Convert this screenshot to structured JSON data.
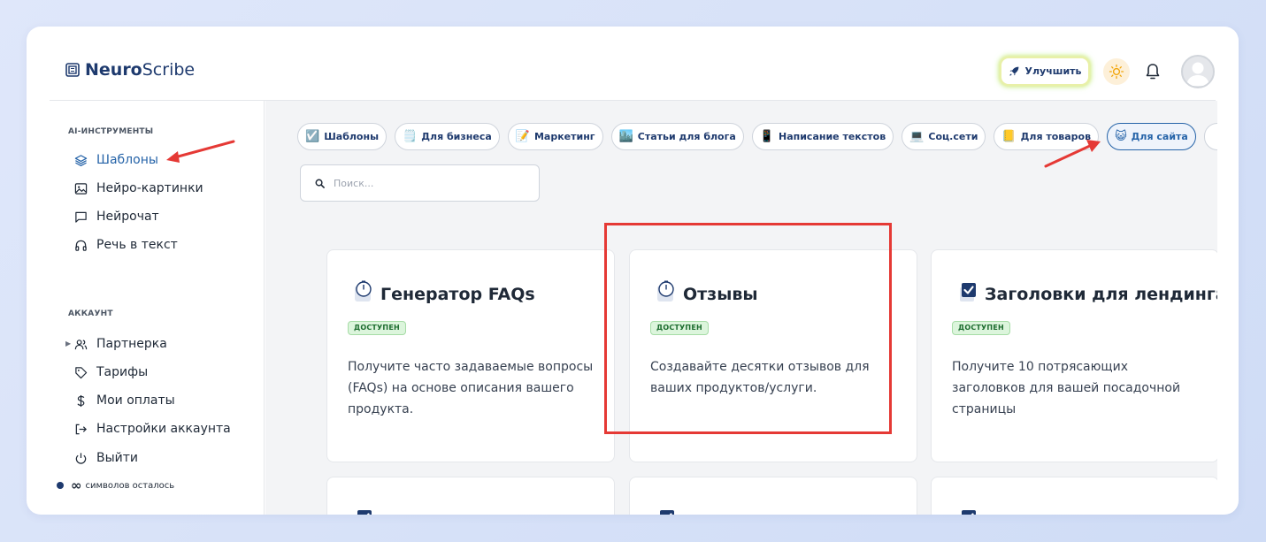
{
  "app": {
    "logo_bold": "Neuro",
    "logo_regular": "Scribe"
  },
  "header": {
    "upgrade_label": "Улучшить"
  },
  "sidebar": {
    "section_ai": "AI-ИНСТРУМЕНТЫ",
    "ai_items": [
      {
        "label": "Шаблоны",
        "icon": "layers-icon",
        "active": true
      },
      {
        "label": "Нейро-картинки",
        "icon": "image-icon"
      },
      {
        "label": "Нейрочат",
        "icon": "chat-icon"
      },
      {
        "label": "Речь в текст",
        "icon": "headphones-icon"
      }
    ],
    "section_account": "АККАУНТ",
    "account_items": [
      {
        "label": "Партнерка",
        "icon": "users-icon"
      },
      {
        "label": "Тарифы",
        "icon": "tag-icon"
      },
      {
        "label": "Мои оплаты",
        "icon": "dollar-icon"
      },
      {
        "label": "Настройки аккаунта",
        "icon": "logout-icon"
      },
      {
        "label": "Выйти",
        "icon": "power-icon"
      }
    ],
    "credits_symbol": "∞",
    "credits_label": "символов осталось"
  },
  "tabs": [
    {
      "emoji": "☑️",
      "label": "Шаблоны"
    },
    {
      "emoji": "🗒️",
      "label": "Для бизнеса"
    },
    {
      "emoji": "📝",
      "label": "Маркетинг"
    },
    {
      "emoji": "🏙️",
      "label": "Статьи для блога"
    },
    {
      "emoji": "📱",
      "label": "Написание текстов"
    },
    {
      "emoji": "💻",
      "label": "Соц.сети"
    },
    {
      "emoji": "📒",
      "label": "Для товаров"
    },
    {
      "emoji": "😺",
      "label": "Для сайта",
      "active": true
    }
  ],
  "search": {
    "placeholder": "Поиск..."
  },
  "cards": [
    {
      "title": "Генератор FAQs",
      "icon": "stopwatch-icon",
      "badge": "ДОСТУПЕН",
      "description": "Получите часто задаваемые вопросы (FAQs) на основе описания вашего продукта."
    },
    {
      "title": "Отзывы",
      "icon": "stopwatch-icon",
      "badge": "ДОСТУПЕН",
      "description": "Создавайте десятки отзывов для ваших продуктов/услуги."
    },
    {
      "title": "Заголовки для лендинга",
      "icon": "checkbox-icon",
      "badge": "ДОСТУПЕН",
      "description": "Получите 10 потрясающих заголовков для вашей посадочной страницы"
    }
  ],
  "colors": {
    "accent": "#2563a8",
    "brand": "#1e3a6e",
    "badge_bg": "#dcf5dc",
    "badge_text": "#1b6b2d",
    "highlight": "#e53935"
  }
}
